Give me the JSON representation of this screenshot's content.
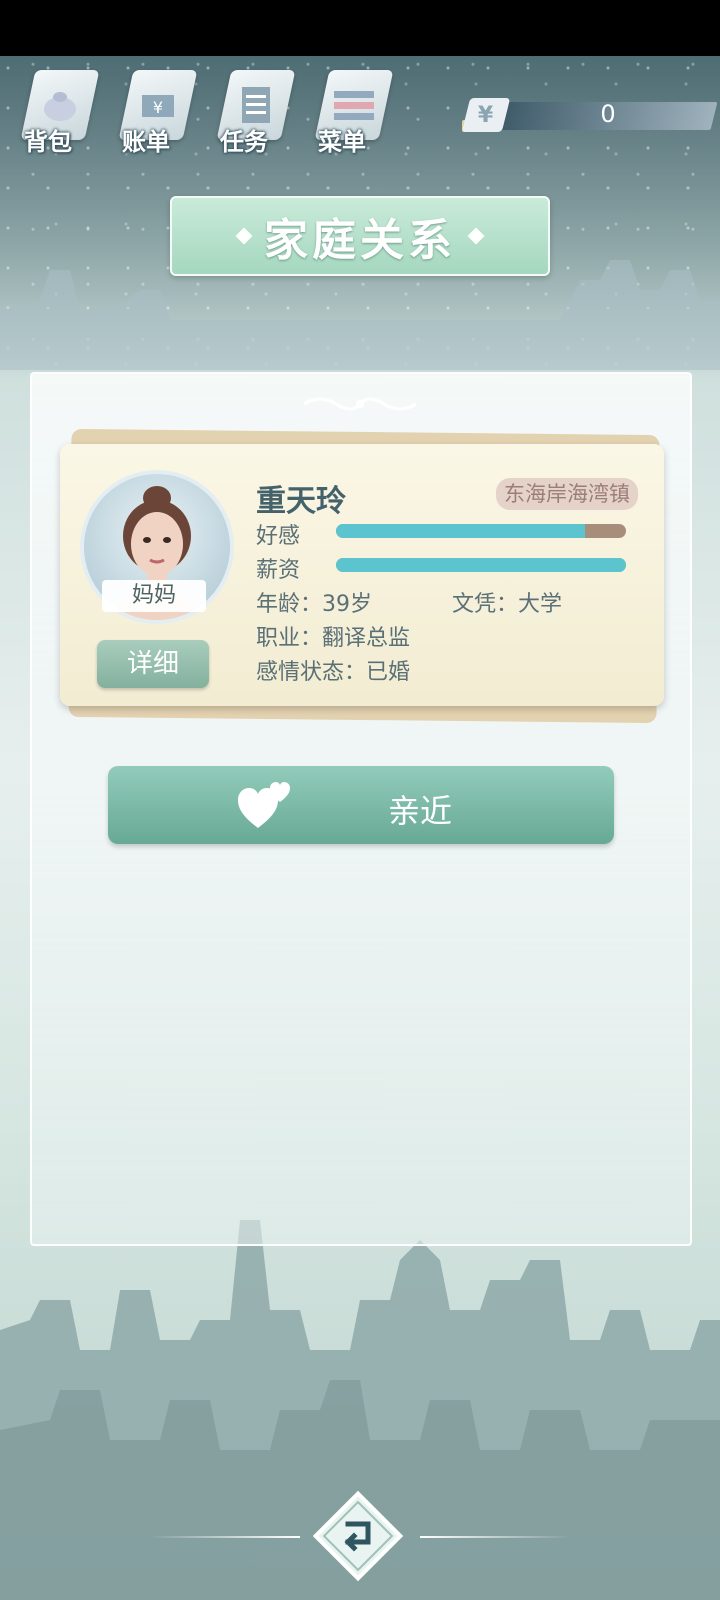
{
  "topnav": {
    "items": [
      {
        "label": "背包",
        "icon": "backpack-icon"
      },
      {
        "label": "账单",
        "icon": "bill-icon"
      },
      {
        "label": "任务",
        "icon": "task-list-icon"
      },
      {
        "label": "菜单",
        "icon": "menu-icon"
      }
    ]
  },
  "money": {
    "currency_symbol": "¥",
    "value": "0"
  },
  "page": {
    "title": "家庭关系"
  },
  "card": {
    "name": "重天玲",
    "role": "妈妈",
    "location": "东海岸海湾镇",
    "affection_label": "好感",
    "affection_level": 0.86,
    "salary_label": "薪资",
    "salary_level": 1.0,
    "age_text": "年龄：39岁",
    "education_text": "文凭：大学",
    "job_text": "职业：翻译总监",
    "relationship_text": "感情状态：已婚",
    "detail_button": "详细"
  },
  "actions": {
    "approach_label": "亲近"
  },
  "colors": {
    "accent": "#67a995",
    "bar": "#5cc4cf",
    "bar_bg": "#a78e7a"
  }
}
